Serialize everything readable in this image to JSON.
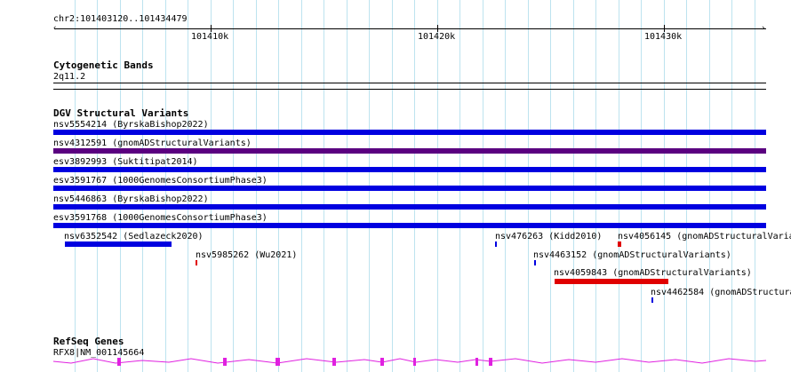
{
  "ruler": {
    "location": "chr2:101403120..101434479",
    "ticks": [
      "101410k",
      "101420k",
      "101430k"
    ]
  },
  "cytobands": {
    "title": "Cytogenetic Bands",
    "band_label": "2q11.2"
  },
  "dgv": {
    "title": "DGV Structural Variants",
    "colors": {
      "blue": "#0000e0",
      "purple": "#5a0080",
      "red": "#e00000"
    },
    "features": [
      {
        "label": "nsv5554214 (ByrskaBishop2022)",
        "color": "blue"
      },
      {
        "label": "nsv4312591 (gnomADStructuralVariants)",
        "color": "purple"
      },
      {
        "label": "esv3892993 (Suktitipat2014)",
        "color": "blue"
      },
      {
        "label": "esv3591767 (1000GenomesConsortiumPhase3)",
        "color": "blue"
      },
      {
        "label": "nsv5446863 (ByrskaBishop2022)",
        "color": "blue"
      },
      {
        "label": "esv3591768 (1000GenomesConsortiumPhase3)",
        "color": "blue"
      },
      {
        "label": "nsv6352542 (Sedlazeck2020)",
        "color": "blue"
      },
      {
        "label": "nsv5985262 (Wu2021)",
        "color": "red"
      },
      {
        "label": "nsv476263 (Kidd2010)",
        "color": "blue"
      },
      {
        "label": "nsv4056145 (gnomADStructuralVaria",
        "color": "red"
      },
      {
        "label": "nsv4463152 (gnomADStructuralVariants)",
        "color": "blue"
      },
      {
        "label": "nsv4059843 (gnomADStructuralVariants)",
        "color": "red"
      },
      {
        "label": "nsv4462584 (gnomADStructura",
        "color": "blue"
      }
    ]
  },
  "refseq": {
    "title": "RefSeq Genes",
    "gene_label": "RFX8|NM_001145664",
    "color": "#e020e0"
  }
}
